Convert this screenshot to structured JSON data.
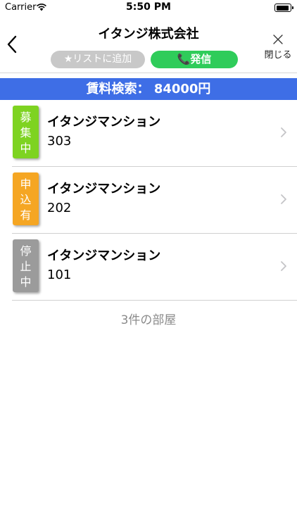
{
  "status_bar": {
    "carrier": "Carrier",
    "time": "5:50 PM"
  },
  "nav": {
    "title": "イタンジ株式会社",
    "add_to_list_label": "★リストに追加",
    "call_label": "📞発信",
    "close_label": "閉じる"
  },
  "banner": {
    "text": "賃料検索： 84000円",
    "color": "#3e6ee6"
  },
  "rooms": [
    {
      "status": "募集中",
      "status_chars": [
        "募",
        "集",
        "中"
      ],
      "status_color": "#7ed321",
      "building": "イタンジマンション",
      "room": "303"
    },
    {
      "status": "申込有",
      "status_chars": [
        "申",
        "込",
        "有"
      ],
      "status_color": "#f5a623",
      "building": "イタンジマンション",
      "room": "202"
    },
    {
      "status": "停止中",
      "status_chars": [
        "停",
        "止",
        "中"
      ],
      "status_color": "#9b9b9b",
      "building": "イタンジマンション",
      "room": "101"
    }
  ],
  "footer": {
    "count_text": "3件の部屋"
  },
  "icons": {
    "back": "chevron-left-icon",
    "close": "close-icon",
    "wifi": "wifi-icon",
    "battery": "battery-icon",
    "row_chevron": "chevron-right-icon"
  }
}
